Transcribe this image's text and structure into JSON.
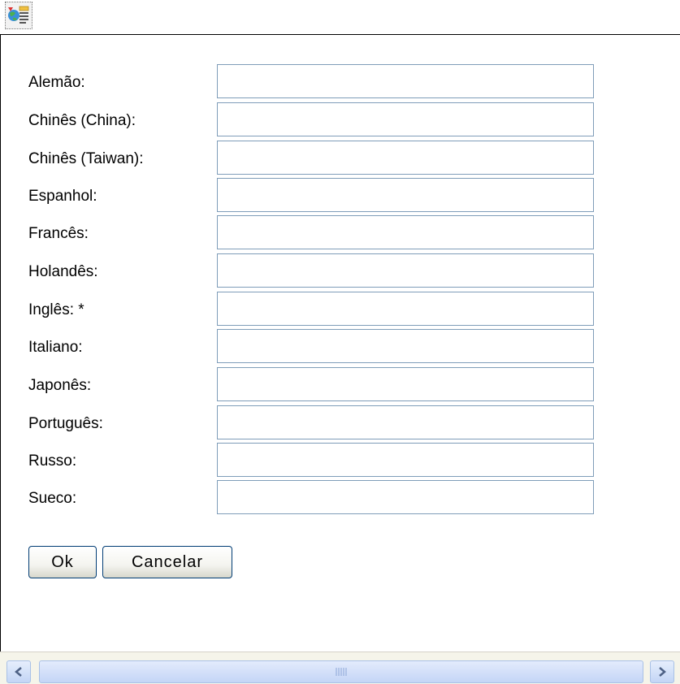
{
  "toolbar": {
    "icon": "translate-icon"
  },
  "form": {
    "fields": [
      {
        "label": "Alemão:",
        "value": ""
      },
      {
        "label": "Chinês (China):",
        "value": ""
      },
      {
        "label": "Chinês (Taiwan):",
        "value": ""
      },
      {
        "label": "Espanhol:",
        "value": ""
      },
      {
        "label": "Francês:",
        "value": ""
      },
      {
        "label": "Holandês:",
        "value": ""
      },
      {
        "label": "Inglês: *",
        "value": ""
      },
      {
        "label": "Italiano:",
        "value": ""
      },
      {
        "label": "Japonês:",
        "value": ""
      },
      {
        "label": "Português:",
        "value": ""
      },
      {
        "label": "Russo:",
        "value": ""
      },
      {
        "label": "Sueco:",
        "value": ""
      }
    ]
  },
  "buttons": {
    "ok": "Ok",
    "cancel": "Cancelar"
  },
  "scrollbar": {
    "left_icon": "chevron-left-icon",
    "right_icon": "chevron-right-icon",
    "grip_icon": "grip-icon"
  },
  "colors": {
    "field_border": "#7f9db9",
    "button_border": "#003c74",
    "scrollbar": "#c3d5f5"
  }
}
